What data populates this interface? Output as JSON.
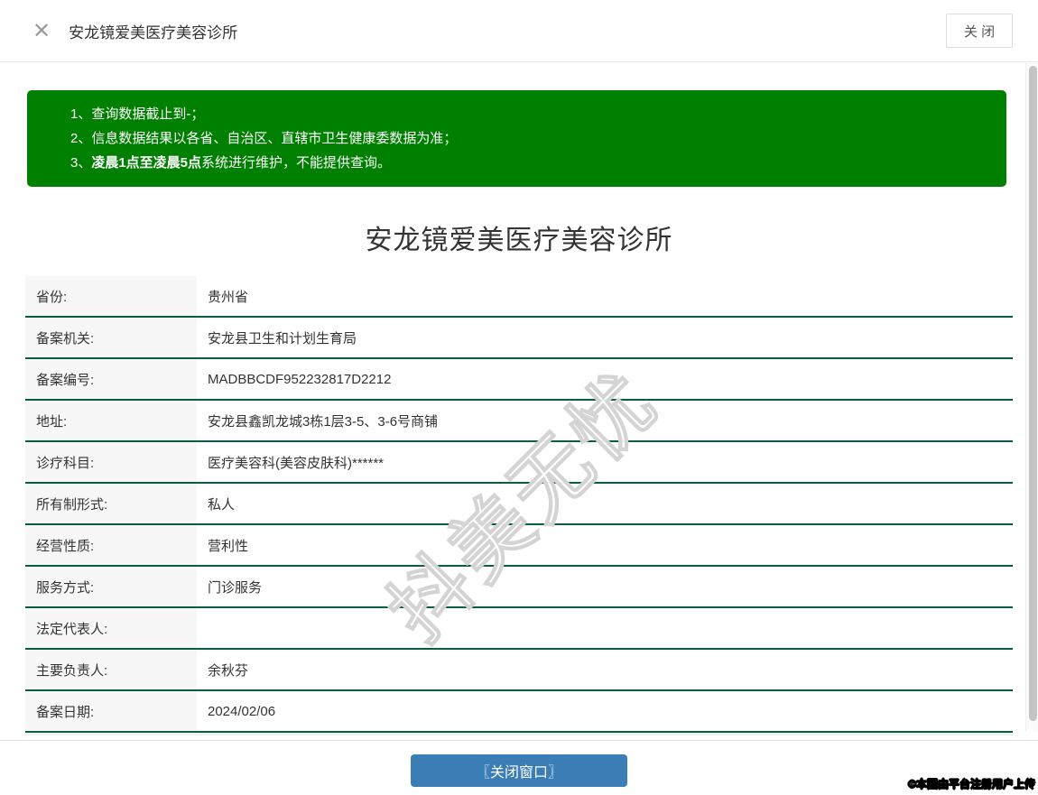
{
  "header": {
    "close_icon": "✕",
    "title": "安龙镜爱美医疗美容诊所",
    "close_button_label": "关 闭"
  },
  "notice": {
    "items": [
      {
        "text": "1、查询数据截止到-；",
        "bold": "",
        "rest": ""
      },
      {
        "text": "2、信息数据结果以各省、自治区、直辖市卫生健康委数据为准；",
        "bold": "",
        "rest": ""
      },
      {
        "text": "3、",
        "bold": "凌晨1点至凌晨5点",
        "rest": "系统进行维护，不能提供查询。"
      }
    ]
  },
  "content": {
    "title": "安龙镜爱美医疗美容诊所",
    "rows": [
      {
        "label": "省份:",
        "value": "贵州省"
      },
      {
        "label": "备案机关:",
        "value": "安龙县卫生和计划生育局"
      },
      {
        "label": "备案编号:",
        "value": "MADBBCDF952232817D2212"
      },
      {
        "label": "地址:",
        "value": "安龙县鑫凯龙城3栋1层3-5、3-6号商铺"
      },
      {
        "label": "诊疗科目:",
        "value": "医疗美容科(美容皮肤科)******"
      },
      {
        "label": "所有制形式:",
        "value": "私人"
      },
      {
        "label": "经营性质:",
        "value": "营利性"
      },
      {
        "label": "服务方式:",
        "value": "门诊服务"
      },
      {
        "label": "法定代表人:",
        "value": ""
      },
      {
        "label": "主要负责人:",
        "value": "余秋芬"
      },
      {
        "label": "备案日期:",
        "value": "2024/02/06"
      }
    ]
  },
  "footer": {
    "close_button_label": "〖关闭窗口〗"
  },
  "watermark": "抖美无忧",
  "copyright": "©本图由平台注册用户上传",
  "colors": {
    "notice_green": "#008000",
    "table_border_green": "#0b5d41",
    "button_blue": "#3b7db5",
    "label_cell_bg": "#f7f7f7"
  }
}
